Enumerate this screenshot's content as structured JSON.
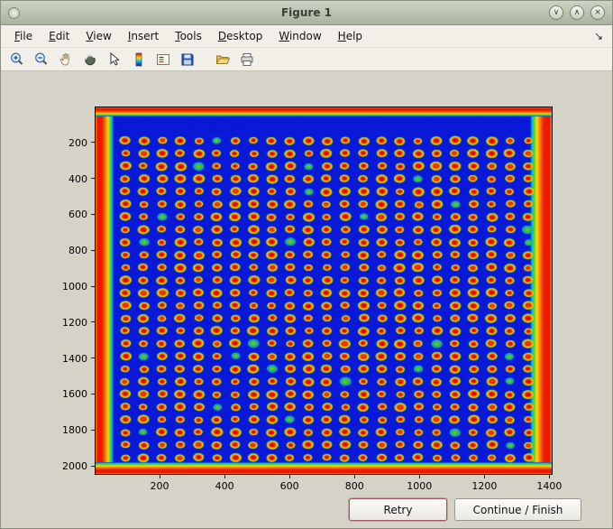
{
  "window": {
    "title": "Figure 1",
    "controls": {
      "shade": "∨",
      "maximize": "∧",
      "close": "×"
    }
  },
  "menu": {
    "items": [
      "File",
      "Edit",
      "View",
      "Insert",
      "Tools",
      "Desktop",
      "Window",
      "Help"
    ],
    "dock_icon": "↘"
  },
  "toolbar": {
    "tools": [
      "zoom-in",
      "zoom-out",
      "pan",
      "rotate-3d",
      "data-cursor",
      "insert-colorbar",
      "insert-legend",
      "save-figure",
      "open-file",
      "print-figure"
    ]
  },
  "plot": {
    "type": "image-heatmap",
    "colormap": "jet",
    "x_ticks": [
      200,
      400,
      600,
      800,
      1000,
      1200,
      1400
    ],
    "y_ticks": [
      200,
      400,
      600,
      800,
      1000,
      1200,
      1400,
      1600,
      1800,
      2000
    ],
    "x_max": 1410,
    "y_max": 2050,
    "grid": {
      "rows": 26,
      "cols": 23
    },
    "colors": {
      "background_blue": "#0a18d8",
      "spot_core": "#b80000",
      "spot_mid": "#ff8000",
      "spot_rim": "#ffdf00",
      "spot_halo": "#4fcf1f",
      "edge_band": "#f02000"
    }
  },
  "buttons": {
    "retry": "Retry",
    "continue_finish": "Continue / Finish"
  }
}
